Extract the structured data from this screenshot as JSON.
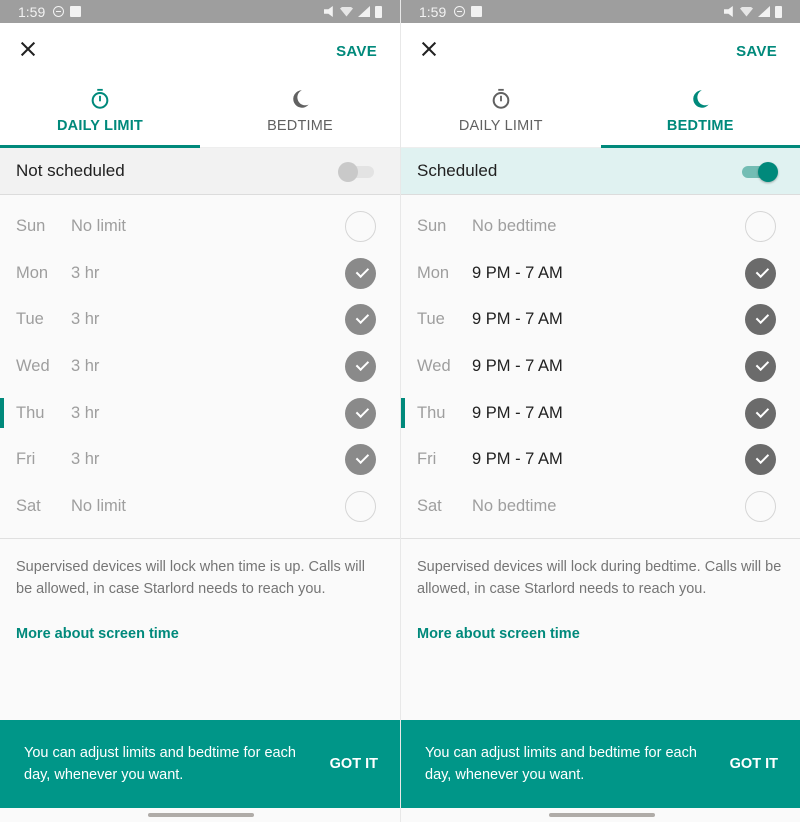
{
  "status_bar": {
    "time": "1:59"
  },
  "screens": [
    {
      "id": "daily-limit",
      "save_label": "SAVE",
      "tabs": [
        {
          "label": "DAILY LIMIT",
          "icon": "timer-icon",
          "active": true
        },
        {
          "label": "BEDTIME",
          "icon": "moon-icon",
          "active": false
        }
      ],
      "schedule": {
        "label": "Not scheduled",
        "enabled": false
      },
      "days": [
        {
          "day": "Sun",
          "value": "No limit",
          "checked": false,
          "today": false
        },
        {
          "day": "Mon",
          "value": "3 hr",
          "checked": true,
          "today": false
        },
        {
          "day": "Tue",
          "value": "3 hr",
          "checked": true,
          "today": false
        },
        {
          "day": "Wed",
          "value": "3 hr",
          "checked": true,
          "today": false
        },
        {
          "day": "Thu",
          "value": "3 hr",
          "checked": true,
          "today": true
        },
        {
          "day": "Fri",
          "value": "3 hr",
          "checked": true,
          "today": false
        },
        {
          "day": "Sat",
          "value": "No limit",
          "checked": false,
          "today": false
        }
      ],
      "info_text": "Supervised devices will lock when time is up. Calls will be allowed, in case Starlord needs to reach you.",
      "more_link": "More about screen time",
      "snackbar": {
        "text": "You can adjust limits and bedtime for each day, whenever you want.",
        "action": "GOT IT"
      }
    },
    {
      "id": "bedtime",
      "save_label": "SAVE",
      "tabs": [
        {
          "label": "DAILY LIMIT",
          "icon": "timer-icon",
          "active": false
        },
        {
          "label": "BEDTIME",
          "icon": "moon-icon",
          "active": true
        }
      ],
      "schedule": {
        "label": "Scheduled",
        "enabled": true
      },
      "days": [
        {
          "day": "Sun",
          "value": "No bedtime",
          "checked": false,
          "today": false
        },
        {
          "day": "Mon",
          "value": "9 PM - 7 AM",
          "checked": true,
          "today": false
        },
        {
          "day": "Tue",
          "value": "9 PM - 7 AM",
          "checked": true,
          "today": false
        },
        {
          "day": "Wed",
          "value": "9 PM - 7 AM",
          "checked": true,
          "today": false
        },
        {
          "day": "Thu",
          "value": "9 PM - 7 AM",
          "checked": true,
          "today": true
        },
        {
          "day": "Fri",
          "value": "9 PM - 7 AM",
          "checked": true,
          "today": false
        },
        {
          "day": "Sat",
          "value": "No bedtime",
          "checked": false,
          "today": false
        }
      ],
      "info_text": "Supervised devices will lock during bedtime. Calls will be allowed, in case Starlord needs to reach you.",
      "more_link": "More about screen time",
      "snackbar": {
        "text": "You can adjust limits and bedtime for each day, whenever you want.",
        "action": "GOT IT"
      }
    }
  ],
  "colors": {
    "accent": "#00897b",
    "snackbar": "#009688",
    "status_bar": "#9e9e9e"
  }
}
